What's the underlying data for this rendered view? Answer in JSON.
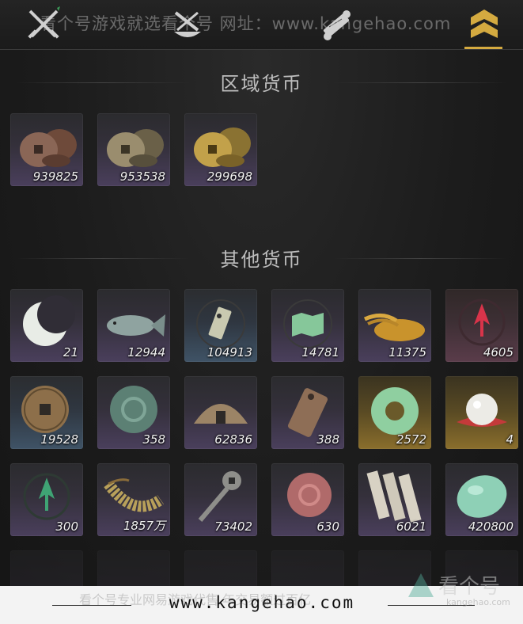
{
  "watermark_top": "看个号游戏就选看个号   网址：www.kangehao.com",
  "tabs": [
    {
      "icon": "crossed-swords-icon"
    },
    {
      "icon": "dye-bowl-icon"
    },
    {
      "icon": "scroll-icon"
    },
    {
      "icon": "currency-chevron-icon"
    }
  ],
  "sections": {
    "regional": {
      "title": "区域货币"
    },
    "other": {
      "title": "其他货币"
    }
  },
  "regional_items": [
    {
      "icon": "bronze-coin-stack-icon",
      "count": "939825"
    },
    {
      "icon": "silver-coin-stack-icon",
      "count": "953538"
    },
    {
      "icon": "gold-coin-stack-icon",
      "count": "299698"
    }
  ],
  "other_items": [
    {
      "icon": "moon-jade-icon",
      "count": "21"
    },
    {
      "icon": "fish-icon",
      "count": "12944"
    },
    {
      "icon": "token-plaque-icon",
      "count": "104913"
    },
    {
      "icon": "map-icon",
      "count": "14781"
    },
    {
      "icon": "grain-pile-icon",
      "count": "11375"
    },
    {
      "icon": "red-sigil-icon",
      "count": "4605"
    },
    {
      "icon": "bronze-coin-icon",
      "count": "19528"
    },
    {
      "icon": "jade-disc-icon",
      "count": "358"
    },
    {
      "icon": "half-coin-icon",
      "count": "62836"
    },
    {
      "icon": "bronze-tablet-icon",
      "count": "388"
    },
    {
      "icon": "jade-ring-icon",
      "count": "2572"
    },
    {
      "icon": "pearl-icon",
      "count": "4"
    },
    {
      "icon": "green-sigil-icon",
      "count": "300"
    },
    {
      "icon": "coin-string-icon",
      "count": "1857万"
    },
    {
      "icon": "coin-sword-icon",
      "count": "73402"
    },
    {
      "icon": "red-stone-disc-icon",
      "count": "630"
    },
    {
      "icon": "bamboo-slips-icon",
      "count": "6021"
    },
    {
      "icon": "jade-pebble-icon",
      "count": "420800"
    }
  ],
  "footer": {
    "url": "www.kangehao.com",
    "ghost_text": "看个号专业网易游戏代售 年交易额过百亿"
  },
  "logo": {
    "text": "看个号",
    "sub": "kangehao.com"
  },
  "colors": {
    "accent_gold": "#d4aa40",
    "card_purple": "#4a3f5c",
    "card_gold": "#8a6e2c",
    "card_blue": "#3f5366"
  }
}
